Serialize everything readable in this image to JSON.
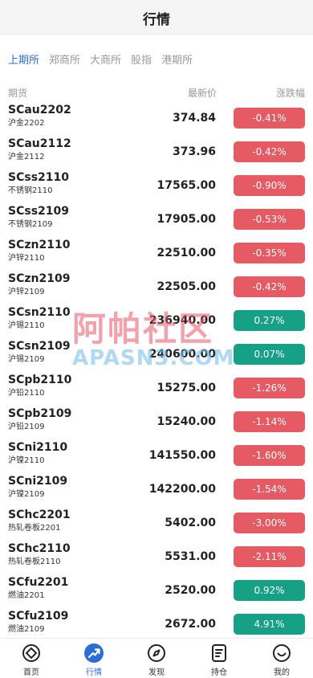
{
  "header": {
    "title": "行情"
  },
  "tabs": [
    {
      "label": "上期所",
      "active": true
    },
    {
      "label": "郑商所",
      "active": false
    },
    {
      "label": "大商所",
      "active": false
    },
    {
      "label": "股指",
      "active": false
    },
    {
      "label": "港期所",
      "active": false
    }
  ],
  "columns": {
    "name": "期货",
    "price": "最新价",
    "change": "涨跌幅"
  },
  "colors": {
    "up": "#e65a64",
    "down": "#16a086",
    "accent": "#2b6fd6"
  },
  "rows": [
    {
      "symbol": "SCau2202",
      "name": "沪金2202",
      "price": "374.84",
      "change": "-0.41%",
      "dir": "up"
    },
    {
      "symbol": "SCau2112",
      "name": "沪金2112",
      "price": "373.96",
      "change": "-0.42%",
      "dir": "up"
    },
    {
      "symbol": "SCss2110",
      "name": "不锈钢2110",
      "price": "17565.00",
      "change": "-0.90%",
      "dir": "up"
    },
    {
      "symbol": "SCss2109",
      "name": "不锈钢2109",
      "price": "17905.00",
      "change": "-0.53%",
      "dir": "up"
    },
    {
      "symbol": "SCzn2110",
      "name": "沪锌2110",
      "price": "22510.00",
      "change": "-0.35%",
      "dir": "up"
    },
    {
      "symbol": "SCzn2109",
      "name": "沪锌2109",
      "price": "22505.00",
      "change": "-0.42%",
      "dir": "up"
    },
    {
      "symbol": "SCsn2110",
      "name": "沪锡2110",
      "price": "236940.00",
      "change": "0.27%",
      "dir": "down"
    },
    {
      "symbol": "SCsn2109",
      "name": "沪锡2109",
      "price": "240600.00",
      "change": "0.07%",
      "dir": "down"
    },
    {
      "symbol": "SCpb2110",
      "name": "沪铅2110",
      "price": "15275.00",
      "change": "-1.26%",
      "dir": "up"
    },
    {
      "symbol": "SCpb2109",
      "name": "沪铅2109",
      "price": "15240.00",
      "change": "-1.14%",
      "dir": "up"
    },
    {
      "symbol": "SCni2110",
      "name": "沪镍2110",
      "price": "141550.00",
      "change": "-1.60%",
      "dir": "up"
    },
    {
      "symbol": "SCni2109",
      "name": "沪镍2109",
      "price": "142200.00",
      "change": "-1.54%",
      "dir": "up"
    },
    {
      "symbol": "SChc2201",
      "name": "热轧卷板2201",
      "price": "5402.00",
      "change": "-3.00%",
      "dir": "up"
    },
    {
      "symbol": "SChc2110",
      "name": "热轧卷板2110",
      "price": "5531.00",
      "change": "-2.11%",
      "dir": "up"
    },
    {
      "symbol": "SCfu2201",
      "name": "燃油2201",
      "price": "2520.00",
      "change": "0.92%",
      "dir": "down"
    },
    {
      "symbol": "SCfu2109",
      "name": "燃油2109",
      "price": "2672.00",
      "change": "4.91%",
      "dir": "down"
    }
  ],
  "watermark": {
    "cn": "阿帕社区",
    "en": "APASN3.COM"
  },
  "tabbar": [
    {
      "label": "首页",
      "icon": "home-icon",
      "active": false
    },
    {
      "label": "行情",
      "icon": "trend-icon",
      "active": true
    },
    {
      "label": "发现",
      "icon": "compass-icon",
      "active": false
    },
    {
      "label": "持仓",
      "icon": "document-icon",
      "active": false
    },
    {
      "label": "我的",
      "icon": "smiley-icon",
      "active": false
    }
  ]
}
